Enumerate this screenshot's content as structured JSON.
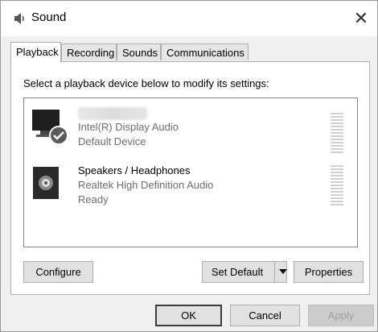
{
  "window": {
    "title": "Sound",
    "close_glyph": "✕",
    "app_icon": "speaker-icon"
  },
  "tabs": [
    {
      "label": "Playback",
      "active": true
    },
    {
      "label": "Recording",
      "active": false
    },
    {
      "label": "Sounds",
      "active": false
    },
    {
      "label": "Communications",
      "active": false
    }
  ],
  "playback": {
    "instruction": "Select a playback device below to modify its settings:",
    "devices": [
      {
        "name": "",
        "name_obscured": true,
        "driver": "Intel(R) Display Audio",
        "status": "Default Device",
        "icon": "monitor-icon",
        "badge": "green-check-icon",
        "dimmed": true
      },
      {
        "name": "Speakers / Headphones",
        "driver": "Realtek High Definition Audio",
        "status": "Ready",
        "icon": "speaker-icon",
        "dimmed": false
      }
    ],
    "buttons": {
      "configure": "Configure",
      "set_default": "Set Default",
      "properties": "Properties"
    }
  },
  "dialog_buttons": {
    "ok": "OK",
    "cancel": "Cancel",
    "apply": "Apply"
  },
  "colors": {
    "check_badge": "#5b5b5b",
    "panel_bg": "#ffffff",
    "window_bg": "#f0f0f0"
  }
}
